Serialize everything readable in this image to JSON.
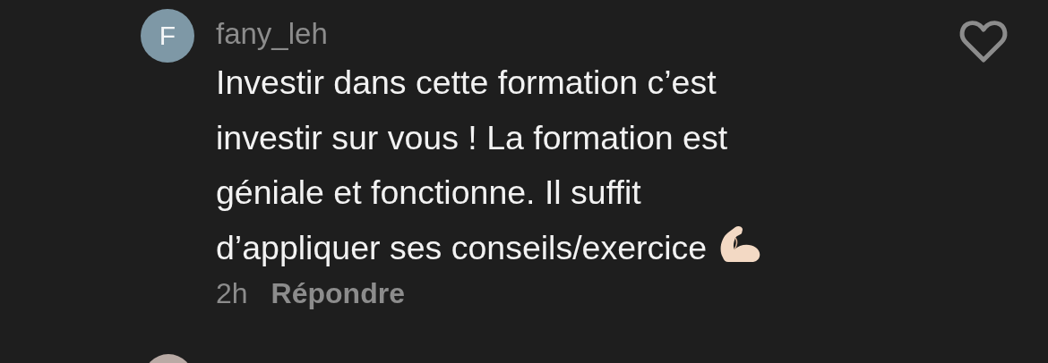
{
  "comment": {
    "avatar_letter": "F",
    "username": "fany_leh",
    "text_lines": [
      "Investir dans cette formation c’est",
      "investir sur vous ! La formation est",
      "géniale et fonctionne. Il suffit",
      "d’appliquer ses conseils/exercice"
    ],
    "time": "2h",
    "reply": "Répondre",
    "liked": false
  }
}
